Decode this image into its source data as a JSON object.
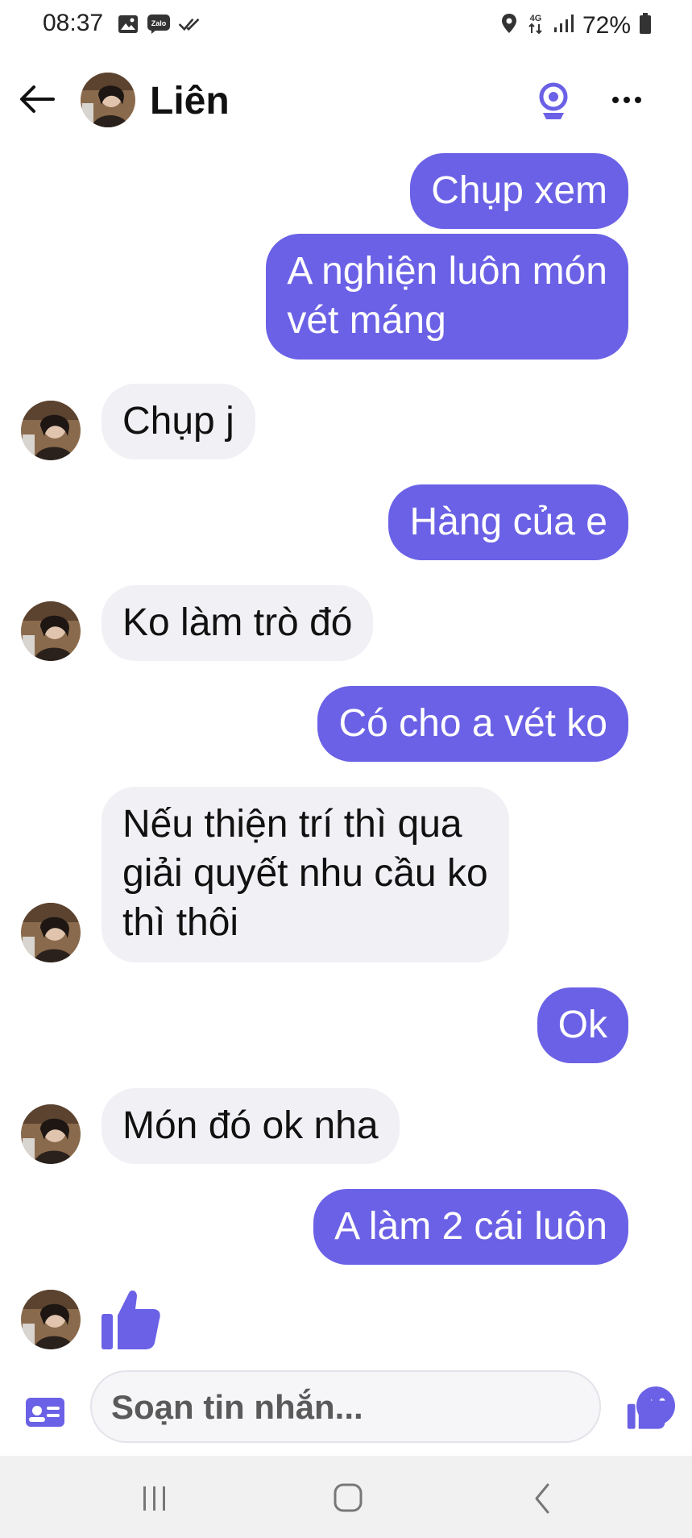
{
  "status_bar": {
    "time": "08:37",
    "battery": "72%",
    "network": "4G",
    "icons_left": [
      "gallery-icon",
      "zalo-icon",
      "check-icon"
    ],
    "icons_right": [
      "location-icon",
      "4g-icon",
      "signal-icon",
      "battery-icon"
    ]
  },
  "header": {
    "contact_name": "Liên",
    "icons": [
      "back-arrow-icon",
      "video-call-icon",
      "more-dots-icon"
    ]
  },
  "messages": [
    {
      "from": "me",
      "text": "Chụp xem"
    },
    {
      "from": "me",
      "text_lines": [
        "A nghiện luôn món",
        "vét máng"
      ]
    },
    {
      "from": "them",
      "text": "Chụp j"
    },
    {
      "from": "me",
      "text": "Hàng của e"
    },
    {
      "from": "them",
      "text": "Ko làm trò đó"
    },
    {
      "from": "me",
      "text": "Có cho a vét ko"
    },
    {
      "from": "them",
      "text_lines": [
        "Nếu thiện trí thì qua",
        "giải quyết nhu cầu ko",
        "thì thôi"
      ]
    },
    {
      "from": "me",
      "text": "Ok"
    },
    {
      "from": "them",
      "text": "Món đó ok nha"
    },
    {
      "from": "me",
      "text": "A làm 2 cái luôn"
    },
    {
      "from": "them",
      "sticker": "thumbs-up-icon"
    }
  ],
  "composer": {
    "placeholder": "Soạn tin nhắn...",
    "icons": [
      "contact-card-icon",
      "emoji-icon",
      "thumbs-up-icon"
    ]
  },
  "nav_bar": {
    "icons": [
      "recent-apps-icon",
      "home-icon",
      "back-icon"
    ]
  },
  "colors": {
    "accent": "#6b61e6",
    "incoming_bubble": "#f1f0f5",
    "outgoing_text": "#ffffff",
    "nav_background": "#f1f1f1"
  }
}
